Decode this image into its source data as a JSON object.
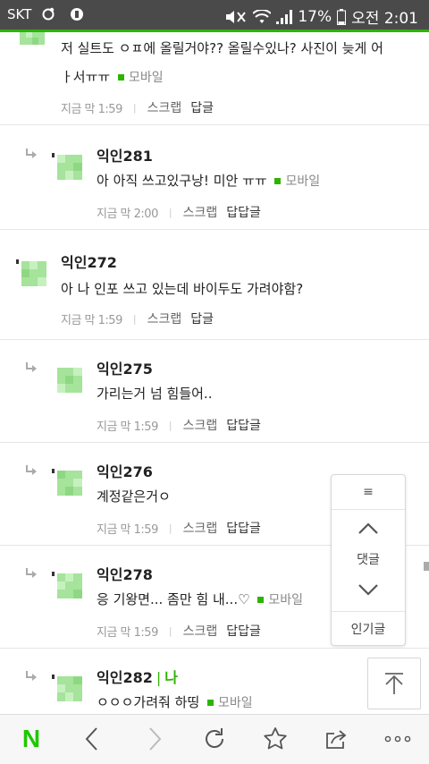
{
  "statusbar": {
    "carrier": "SKT",
    "battery": "17%",
    "time": "오전 2:01"
  },
  "comments": [
    {
      "text_line1": "저 실트도 ㅇㅍ에 올릴거야?? 올릴수있나? 사진이 늦게 어",
      "text_line2": "ㅏ서ㅠㅠ",
      "mobile": "모바일",
      "time": "지금 막 1:59",
      "scrap": "스크랩",
      "reply": "답글"
    },
    {
      "nick": "익인281",
      "text": "아 아직 쓰고있구낭! 미안 ㅠㅠ",
      "mobile": "모바일",
      "time": "지금 막 2:00",
      "scrap": "스크랩",
      "reply": "답답글"
    },
    {
      "nick": "익인272",
      "text": "아 나 인포 쓰고 있는데 바이두도 가려야함?",
      "time": "지금 막 1:59",
      "scrap": "스크랩",
      "reply": "답글"
    },
    {
      "nick": "익인275",
      "text": "가리는거 넘 힘들어..",
      "time": "지금 막 1:59",
      "scrap": "스크랩",
      "reply": "답답글"
    },
    {
      "nick": "익인276",
      "text": "계정같은거ㅇ",
      "time": "지금 막 1:59",
      "scrap": "스크랩",
      "reply": "답답글"
    },
    {
      "nick": "익인278",
      "text": "응 기왕면... 좀만 힘 내...♡",
      "mobile": "모바일",
      "time": "지금 막 1:59",
      "scrap": "스크랩",
      "reply": "답답글"
    },
    {
      "nick": "익인282",
      "badge": "나",
      "text": "ㅇㅇㅇ가려줘 하띵",
      "mobile": "모바일"
    }
  ],
  "floatnav": {
    "menu": "≡",
    "comments": "댓글",
    "popular": "인기글"
  },
  "colors": {
    "accent": "#2db400",
    "statusbar": "#4a4a4a"
  },
  "icons": {
    "naver": "N",
    "back": "chevron-left-icon",
    "forward": "chevron-right-icon",
    "refresh": "refresh-icon",
    "bookmark": "star-icon",
    "share": "share-icon",
    "more": "more-icon"
  }
}
